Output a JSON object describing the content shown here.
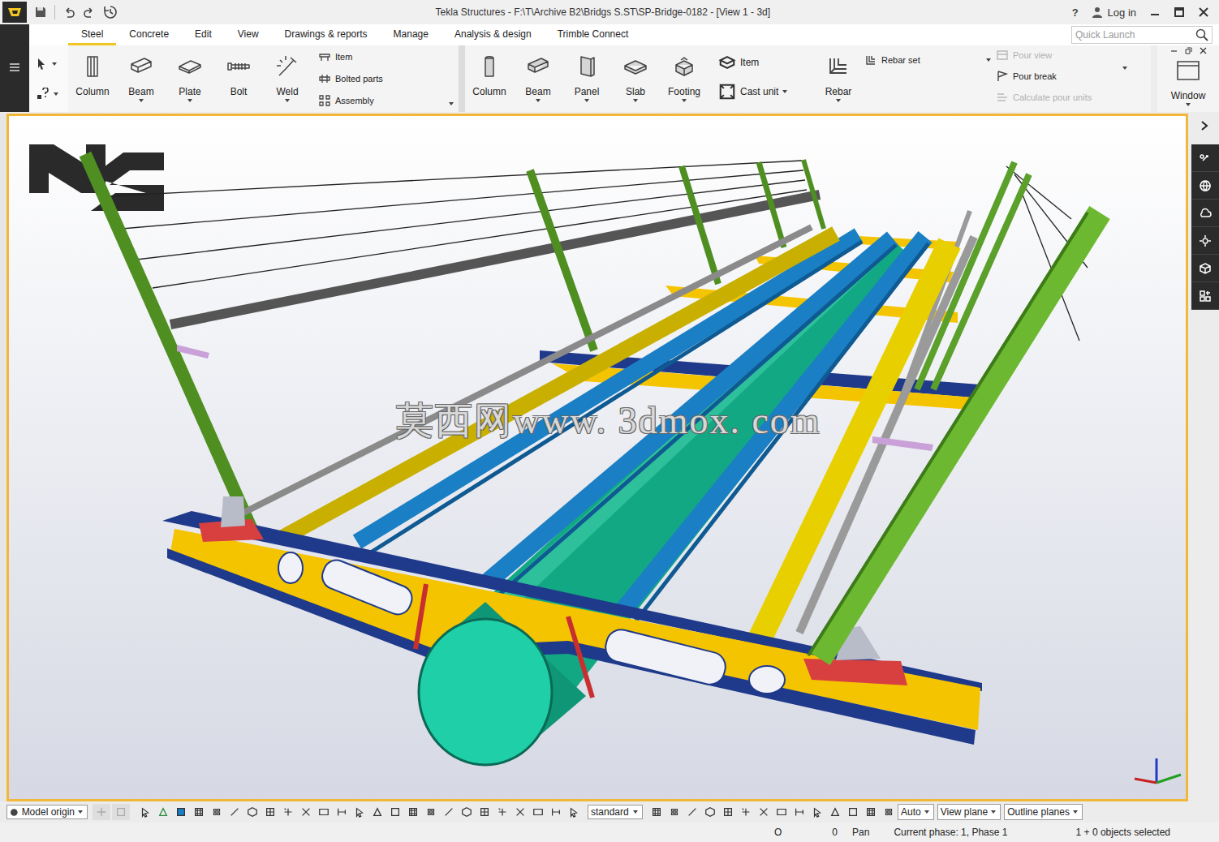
{
  "window": {
    "title": "Tekla Structures - F:\\T\\Archive B2\\Bridgs S.ST\\SP-Bridge-0182  - [View 1 - 3d]",
    "help": "?",
    "login": "Log in"
  },
  "tabs": [
    {
      "label": "Steel",
      "selected": true
    },
    {
      "label": "Concrete",
      "selected": false
    },
    {
      "label": "Edit",
      "selected": false
    },
    {
      "label": "View",
      "selected": false
    },
    {
      "label": "Drawings & reports",
      "selected": false
    },
    {
      "label": "Manage",
      "selected": false
    },
    {
      "label": "Analysis & design",
      "selected": false
    },
    {
      "label": "Trimble Connect",
      "selected": false
    }
  ],
  "quick_launch": {
    "placeholder": "Quick Launch"
  },
  "ribbon": {
    "steel_buttons": [
      {
        "label": "Column",
        "has_menu": false
      },
      {
        "label": "Beam",
        "has_menu": true
      },
      {
        "label": "Plate",
        "has_menu": true
      },
      {
        "label": "Bolt",
        "has_menu": false
      },
      {
        "label": "Weld",
        "has_menu": true
      }
    ],
    "steel_small": [
      {
        "label": "Item"
      },
      {
        "label": "Bolted parts"
      },
      {
        "label": "Assembly"
      }
    ],
    "concrete_buttons": [
      {
        "label": "Column",
        "has_menu": false
      },
      {
        "label": "Beam",
        "has_menu": true
      },
      {
        "label": "Panel",
        "has_menu": true
      },
      {
        "label": "Slab",
        "has_menu": true
      },
      {
        "label": "Footing",
        "has_menu": true
      }
    ],
    "concrete_small": [
      {
        "label": "Item"
      },
      {
        "label": "Cast unit"
      }
    ],
    "rebar": {
      "label": "Rebar",
      "has_menu": true
    },
    "rebar_set": {
      "label": "Rebar set"
    },
    "pour": [
      {
        "label": "Pour view",
        "disabled": true
      },
      {
        "label": "Pour break",
        "disabled": false
      },
      {
        "label": "Calculate pour units",
        "disabled": true
      }
    ],
    "window_button": {
      "label": "Window",
      "has_menu": true
    }
  },
  "viewport": {
    "watermark": "莫西网www. 3dmox. com"
  },
  "bottom_toolbar": {
    "origin": "Model origin",
    "filter": "standard",
    "auto": "Auto",
    "view_plane": "View plane",
    "outline": "Outline planes"
  },
  "status_bar": {
    "x": "O",
    "y": "0",
    "mode": "Pan",
    "phase": "Current phase: 1, Phase 1",
    "selection": "1 + 0 objects selected"
  }
}
